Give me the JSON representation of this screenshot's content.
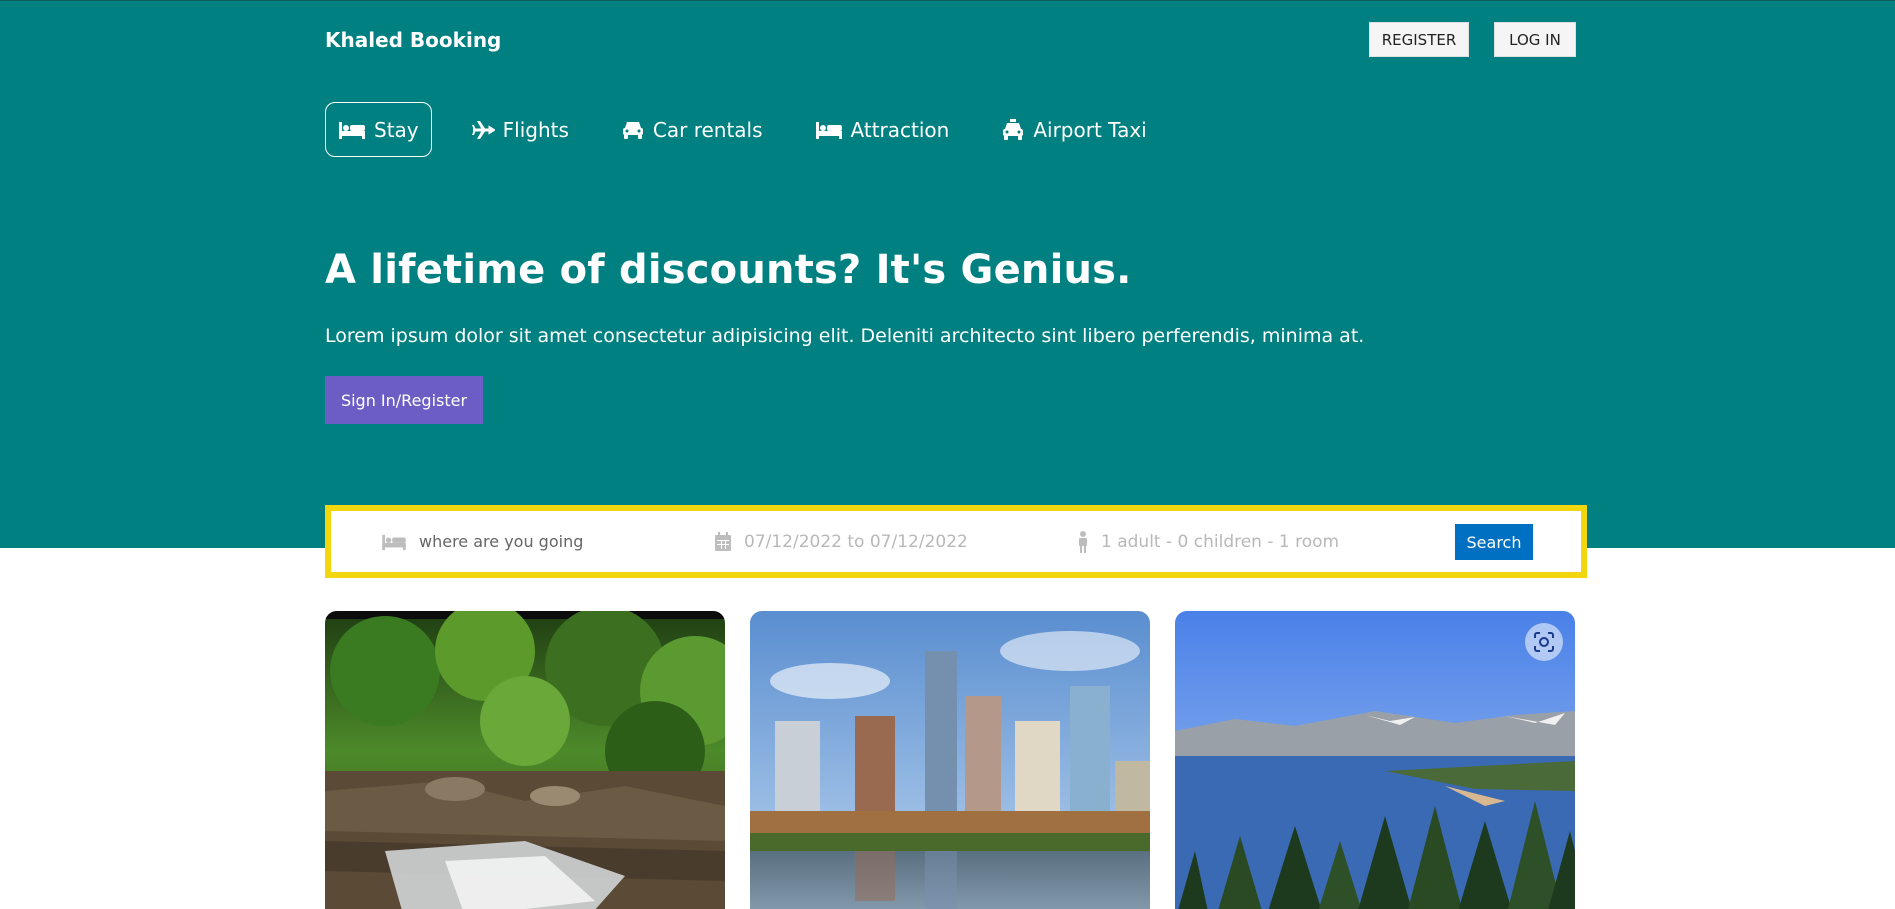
{
  "brand": "Khaled Booking",
  "auth": {
    "register": "REGISTER",
    "login": "LOG IN"
  },
  "nav": [
    {
      "label": "Stay",
      "icon": "bed-icon",
      "active": true
    },
    {
      "label": "Flights",
      "icon": "plane-icon"
    },
    {
      "label": "Car rentals",
      "icon": "car-icon"
    },
    {
      "label": "Attraction",
      "icon": "bed-icon"
    },
    {
      "label": "Airport Taxi",
      "icon": "taxi-icon"
    }
  ],
  "hero": {
    "title": "A lifetime of discounts? It's Genius.",
    "subtitle": "Lorem ipsum dolor sit amet consectetur adipisicing elit. Deleniti architecto sint libero perferendis, minima at.",
    "button": "Sign In/Register"
  },
  "search": {
    "destination_placeholder": "where are you going",
    "dates": "07/12/2022 to 07/12/2022",
    "options": "1 adult - 0 children - 1 room",
    "button": "Search"
  },
  "colors": {
    "header_bg": "#008080",
    "search_border": "#f2d70f",
    "search_button": "#0071c2",
    "hero_button": "#6c5dc4"
  }
}
